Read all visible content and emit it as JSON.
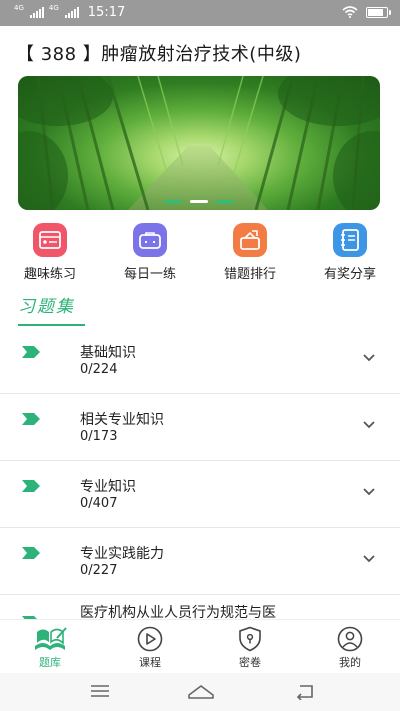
{
  "status_bar": {
    "network_1": "4G",
    "network_2": "4G",
    "time": "15:17",
    "battery_level": 0.9
  },
  "header": {
    "title": "【 388 】肿瘤放射治疗技术(中级)"
  },
  "banner": {
    "image": "bamboo-forest-path",
    "slide_count": 3,
    "active_slide": 2
  },
  "quick_actions": [
    {
      "label": "趣味练习",
      "icon": "quiz-icon",
      "color": "#f0556a"
    },
    {
      "label": "每日一练",
      "icon": "briefcase-icon",
      "color": "#7b74e9"
    },
    {
      "label": "错题排行",
      "icon": "ranking-icon",
      "color": "#f37c45"
    },
    {
      "label": "有奖分享",
      "icon": "notebook-icon",
      "color": "#3d95e6"
    }
  ],
  "section": {
    "title": "习题集"
  },
  "exercise_sets": [
    {
      "name": "基础知识",
      "progress": "0/224"
    },
    {
      "name": "相关专业知识",
      "progress": "0/173"
    },
    {
      "name": "专业知识",
      "progress": "0/407"
    },
    {
      "name": "专业实践能力",
      "progress": "0/227"
    },
    {
      "name": "医疗机构从业人员行为规范与医",
      "progress": ""
    }
  ],
  "tabbar": {
    "items": [
      {
        "label": "题库",
        "icon": "books-icon",
        "active": true
      },
      {
        "label": "课程",
        "icon": "play-icon",
        "active": false
      },
      {
        "label": "密卷",
        "icon": "lock-shield-icon",
        "active": false
      },
      {
        "label": "我的",
        "icon": "profile-icon",
        "active": false
      }
    ]
  },
  "colors": {
    "accent": "#2db37a",
    "status_bar": "#9a9a9a"
  }
}
